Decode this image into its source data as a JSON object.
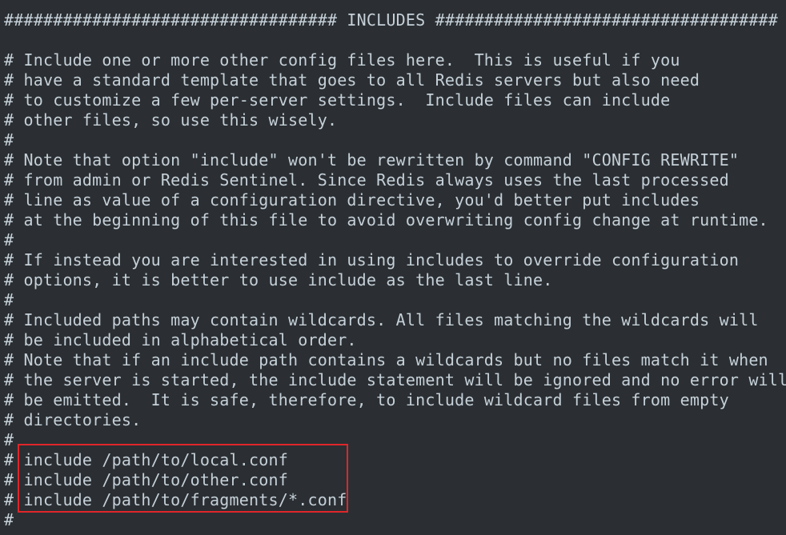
{
  "colors": {
    "background": "#2b2f33",
    "text": "#c5d0d8",
    "highlight_border": "#e0262a"
  },
  "editor": {
    "lines": [
      "################################## INCLUDES ###################################",
      "",
      "# Include one or more other config files here.  This is useful if you",
      "# have a standard template that goes to all Redis servers but also need",
      "# to customize a few per-server settings.  Include files can include",
      "# other files, so use this wisely.",
      "#",
      "# Note that option \"include\" won't be rewritten by command \"CONFIG REWRITE\"",
      "# from admin or Redis Sentinel. Since Redis always uses the last processed",
      "# line as value of a configuration directive, you'd better put includes",
      "# at the beginning of this file to avoid overwriting config change at runtime.",
      "#",
      "# If instead you are interested in using includes to override configuration",
      "# options, it is better to use include as the last line.",
      "#",
      "# Included paths may contain wildcards. All files matching the wildcards will",
      "# be included in alphabetical order.",
      "# Note that if an include path contains a wildcards but no files match it when",
      "# the server is started, the include statement will be ignored and no error will",
      "# be emitted.  It is safe, therefore, to include wildcard files from empty",
      "# directories.",
      "#",
      "# include /path/to/local.conf",
      "# include /path/to/other.conf",
      "# include /path/to/fragments/*.conf",
      "#"
    ]
  }
}
